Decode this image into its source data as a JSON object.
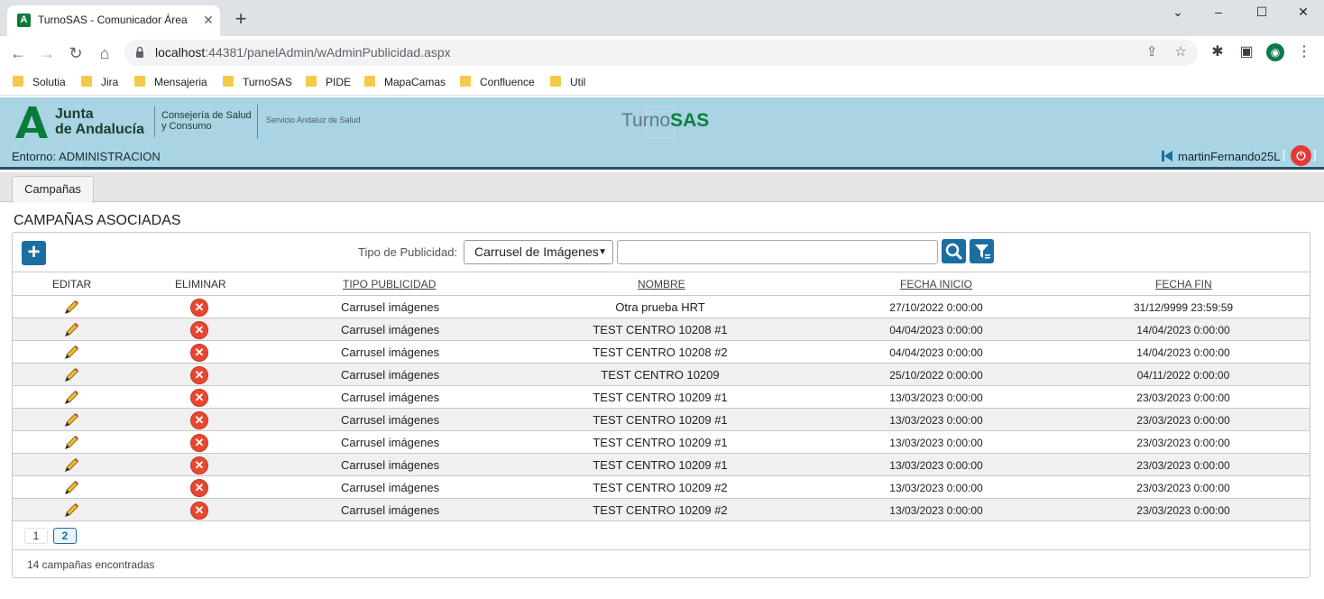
{
  "browser": {
    "tab_title": "TurnoSAS - Comunicador Área",
    "tab_favicon": "A",
    "url_host": "localhost",
    "url_rest": ":44381/panelAdmin/wAdminPublicidad.aspx",
    "bookmarks": [
      "Solutia",
      "Jira",
      "Mensajeria",
      "TurnoSAS",
      "PIDE",
      "MapaCamas",
      "Confluence",
      "Util"
    ]
  },
  "header": {
    "org_line1": "Junta",
    "org_line2": "de Andalucía",
    "consejeria_line1": "Consejería de Salud",
    "consejeria_line2": "y Consumo",
    "sas": "Servicio Andaluz de Salud",
    "brand_left": "Turno",
    "brand_right": "SAS",
    "entorno": "Entorno: ADMINISTRACION",
    "user": "martinFernando25L",
    "bracket_open": "[",
    "bracket_close": "]"
  },
  "tabs": {
    "campanas": "Campañas"
  },
  "section_title": "CAMPAÑAS ASOCIADAS",
  "filter": {
    "label": "Tipo de Publicidad:",
    "selected": "Carrusel de Imágenes",
    "search_value": ""
  },
  "columns": {
    "editar": "EDITAR",
    "eliminar": "ELIMINAR",
    "tipo": "TIPO PUBLICIDAD",
    "nombre": "NOMBRE",
    "inicio": "FECHA INICIO",
    "fin": "FECHA FIN"
  },
  "rows": [
    {
      "tipo": "Carrusel imágenes",
      "nombre": "Otra prueba HRT",
      "inicio": "27/10/2022 0:00:00",
      "fin": "31/12/9999 23:59:59"
    },
    {
      "tipo": "Carrusel imágenes",
      "nombre": "TEST CENTRO 10208 #1",
      "inicio": "04/04/2023 0:00:00",
      "fin": "14/04/2023 0:00:00"
    },
    {
      "tipo": "Carrusel imágenes",
      "nombre": "TEST CENTRO 10208 #2",
      "inicio": "04/04/2023 0:00:00",
      "fin": "14/04/2023 0:00:00"
    },
    {
      "tipo": "Carrusel imágenes",
      "nombre": "TEST CENTRO 10209",
      "inicio": "25/10/2022 0:00:00",
      "fin": "04/11/2022 0:00:00"
    },
    {
      "tipo": "Carrusel imágenes",
      "nombre": "TEST CENTRO 10209 #1",
      "inicio": "13/03/2023 0:00:00",
      "fin": "23/03/2023 0:00:00"
    },
    {
      "tipo": "Carrusel imágenes",
      "nombre": "TEST CENTRO 10209 #1",
      "inicio": "13/03/2023 0:00:00",
      "fin": "23/03/2023 0:00:00"
    },
    {
      "tipo": "Carrusel imágenes",
      "nombre": "TEST CENTRO 10209 #1",
      "inicio": "13/03/2023 0:00:00",
      "fin": "23/03/2023 0:00:00"
    },
    {
      "tipo": "Carrusel imágenes",
      "nombre": "TEST CENTRO 10209 #1",
      "inicio": "13/03/2023 0:00:00",
      "fin": "23/03/2023 0:00:00"
    },
    {
      "tipo": "Carrusel imágenes",
      "nombre": "TEST CENTRO 10209 #2",
      "inicio": "13/03/2023 0:00:00",
      "fin": "23/03/2023 0:00:00"
    },
    {
      "tipo": "Carrusel imágenes",
      "nombre": "TEST CENTRO 10209 #2",
      "inicio": "13/03/2023 0:00:00",
      "fin": "23/03/2023 0:00:00"
    }
  ],
  "pager": {
    "page1": "1",
    "page2": "2",
    "current": 2
  },
  "footer": {
    "count": "14 campañas encontradas"
  },
  "icons": {
    "edit": "pencil-icon",
    "delete": "delete-icon",
    "add": "plus-icon",
    "search": "search-icon",
    "filter": "filter-icon",
    "power": "power-icon"
  },
  "colors": {
    "header_bg": "#a8d4e4",
    "brand_green": "#0a8038",
    "button_blue": "#1a6fa0",
    "delete_red": "#e8472f",
    "power_red": "#e53935"
  }
}
